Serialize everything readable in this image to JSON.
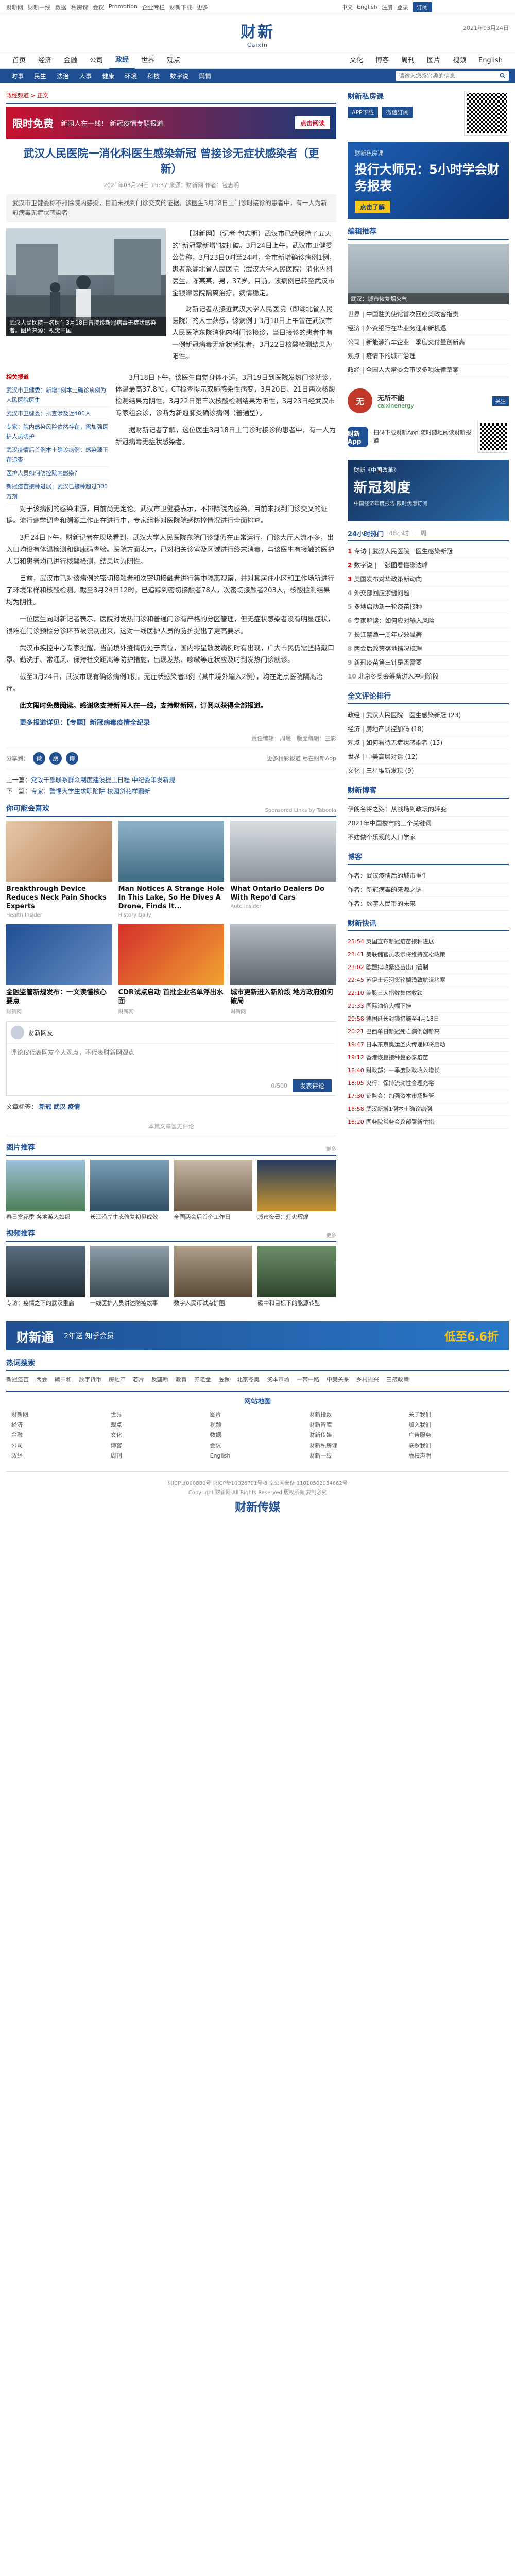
{
  "topbar": {
    "links": [
      "财新网",
      "财新一线",
      "数据",
      "私房课",
      "会议",
      "Promotion",
      "企业专栏",
      "财新下载",
      "更多"
    ],
    "right": [
      "中文",
      "English",
      "注册",
      "登录"
    ],
    "subscribe": "订阅"
  },
  "header": {
    "logo_cn": "财新",
    "logo_en": "Caixin",
    "date": "2021年03月24日"
  },
  "nav": {
    "items": [
      "首页",
      "经济",
      "金融",
      "公司",
      "政经",
      "世界",
      "观点",
      "文化",
      "博客",
      "周刊",
      "图片",
      "视频",
      "English"
    ],
    "active": "政经"
  },
  "subnav": {
    "items": [
      "时事",
      "民生",
      "法治",
      "人事",
      "健康",
      "环境",
      "科技",
      "数字说",
      "舆情"
    ],
    "search_placeholder": "请输入您感兴趣的信息"
  },
  "crumbs": "政经频道 > 正文",
  "banner": {
    "left": "限时免费",
    "mid": "新闻人在一线！ 新冠疫情专题报道",
    "btn": "点击阅读"
  },
  "article": {
    "title": "武汉人民医院一消化科医生感染新冠 曾接诊无症状感染者（更新）",
    "meta": "2021年03月24日 15:37  来源：财新网  作者：包志明",
    "summary": "武汉市卫健委称不排除院内感染，目前未找到门诊交叉的证据。该医生3月18日上门诊时接诊的患者中，有一人为新冠病毒无症状感染者",
    "photo_caption": "武汉人民医院一名医生3月18日曾接诊新冠病毒无症状感染者。图片来源：视觉中国",
    "lead_paragraphs": [
      "【财新网】（记者 包志明）武汉市已经保持了五天的“新冠零新增”被打破。3月24日上午，武汉市卫健委公告称，3月23日0时至24时，全市新增确诊病例1例，患者系湖北省人民医院（武汉大学人民医院）消化内科医生，陈某某，男，37岁。目前，该病例已转至武汉市金银潭医院隔离治疗，病情稳定。",
      "财新记者从接近武汉大学人民医院（即湖北省人民医院）的人士获悉，该病例于3月18日上午曾在武汉市人民医院东院消化内科门诊接诊，当日接诊的患者中有一例新冠病毒无症状感染者，3月22日核酸检测结果为阳性。"
    ],
    "related_head": "相关报道",
    "related": [
      "武汉市卫健委：新增1例本土确诊病例为人民医院医生",
      "武汉市卫健委：排查涉及近400人",
      "专家：院内感染风险依然存在，需加强医护人员防护",
      "武汉疫情后首例本土确诊病例：感染源正在追查",
      "医护人员如何防控院内感染？",
      "新冠疫苗接种进展：武汉已接种超过300万剂"
    ],
    "body_paragraphs": [
      "3月18日下午，该医生自觉身体不适，3月19日到医院发热门诊就诊，体温最高37.8℃，CT检查提示双肺感染性病变，3月20日、21日两次核酸检测结果为阴性，3月22日第三次核酸检测结果为阳性，3月23日经武汉市专家组会诊，诊断为新冠肺炎确诊病例（普通型）。",
      "据财新记者了解，这位医生3月18日上门诊时接诊的患者中，有一人为新冠病毒无症状感染者。",
      "对于该病例的感染来源，目前尚无定论。武汉市卫健委表示，不排除院内感染，目前未找到门诊交叉的证据。流行病学调查和溯源工作正在进行中，专家组将对医院院感防控情况进行全面排查。",
      "3月24日下午，财新记者在现场看到，武汉大学人民医院东院门诊部仍在正常运行，门诊大厅人流不多，出入口均设有体温检测和健康码查验。医院方面表示，已对相关诊室及区域进行终末消毒，与该医生有接触的医护人员和患者均已进行核酸检测，结果均为阴性。",
      "目前，武汉市已对该病例的密切接触者和次密切接触者进行集中隔离观察，并对其居住小区和工作场所进行了环境采样和核酸检测。截至3月24日12时，已追踪到密切接触者78人，次密切接触者203人，核酸检测结果均为阴性。",
      "一位医生向财新记者表示，医院对发热门诊和普通门诊有严格的分区管理，但无症状感染者没有明显症状，很难在门诊预检分诊环节被识别出来，这对一线医护人员的防护提出了更高要求。",
      "武汉市疾控中心专家提醒，当前境外疫情仍处于高位，国内零星散发病例时有出现，广大市民仍需坚持戴口罩、勤洗手、常通风、保持社交距离等防护措施，出现发热、咳嗽等症状应及时到发热门诊就诊。",
      "截至3月24日，武汉市现有确诊病例1例，无症状感染者3例（其中境外输入2例），均在定点医院隔离治疗。"
    ],
    "bold_note": "此文限时免费阅读。感谢您支持新闻人在一线，支持财新网，订阅以获得全部报道。",
    "more_reading": "更多报道详见：【专题】新冠病毒疫情全纪录",
    "editor": "责任编辑：周晟 | 版面编辑：王影"
  },
  "share": {
    "label": "分享到：",
    "icons": [
      "微",
      "朋",
      "博"
    ],
    "app_text": "更多精彩报道 尽在财新App"
  },
  "prevnext": {
    "prev_label": "上一篇：",
    "prev": "党政干部联系群众制度建设提上日程 中纪委印发新规",
    "next_label": "下一篇：",
    "next": "专家：警惕大学生求职陷阱 校园贷花样翻新"
  },
  "recommend": {
    "title": "你可能会喜欢",
    "tag": "Sponsored Links by Taboola",
    "cards": [
      {
        "title": "Breakthrough Device Reduces Neck Pain Shocks Experts",
        "source": "Health Insider"
      },
      {
        "title": "Man Notices A Strange Hole In This Lake, So He Dives A Drone, Finds It...",
        "source": "History Daily"
      },
      {
        "title": "What Ontario Dealers Do With Repo'd Cars",
        "source": "Auto Insider"
      },
      {
        "title": "金融监管新规发布：一文读懂核心要点",
        "source": "财新网"
      },
      {
        "title": "CDR试点启动 首批企业名单浮出水面",
        "source": "财新网"
      },
      {
        "title": "城市更新进入新阶段 地方政府如何破局",
        "source": "财新网"
      }
    ]
  },
  "comment": {
    "user": "财新网友",
    "placeholder": "评论仅代表网友个人观点，不代表财新网观点",
    "submit": "发表评论",
    "count_label": "0/500"
  },
  "tags": {
    "label": "文章标签：",
    "items": [
      "新冠",
      "武汉",
      "疫情"
    ]
  },
  "no_comment": "本篇文章暂无评论",
  "photo_strip": {
    "title": "图片推荐",
    "more": "更多",
    "items": [
      "春日赏花季 各地游人如织",
      "长江沿岸生态修复初见成效",
      "全国两会后首个工作日",
      "城市夜景：灯火辉煌"
    ]
  },
  "video_strip": {
    "title": "视频推荐",
    "more": "更多",
    "items": [
      "专访：疫情之下的武汉重启",
      "一线医护人员讲述防疫故事",
      "数字人民币试点扩围",
      "碳中和目标下的能源转型"
    ]
  },
  "wide_ad": {
    "left": "财新通",
    "mid": "2年送 知乎会员",
    "right": "低至6.6折"
  },
  "hot": {
    "title": "热词搜索",
    "words": [
      "新冠疫苗",
      "两会",
      "碳中和",
      "数字货币",
      "房地产",
      "芯片",
      "反垄断",
      "教育",
      "养老金",
      "医保",
      "北京冬奥",
      "资本市场",
      "一带一路",
      "中美关系",
      "乡村振兴",
      "三孩政策"
    ]
  },
  "footer": {
    "title": "网站地图",
    "cols": [
      [
        "财新网",
        "经济",
        "金融",
        "公司",
        "政经"
      ],
      [
        "世界",
        "观点",
        "文化",
        "博客",
        "周刊"
      ],
      [
        "图片",
        "视频",
        "数据",
        "会议",
        "English"
      ],
      [
        "财新指数",
        "财新智库",
        "财新传媒",
        "财新私房课",
        "财新一线"
      ],
      [
        "关于我们",
        "加入我们",
        "广告服务",
        "联系我们",
        "版权声明"
      ]
    ],
    "copyright": "京ICP证090880号 京ICP备10026701号-8 京公网安备 11010502034662号",
    "legal": "Copyright 财新网 All Rights Reserved 版权所有 复制必究",
    "logo": "财新传媒"
  },
  "right": {
    "qr_title": "财新私房课",
    "qr_buttons": [
      "APP下载",
      "微信订阅"
    ],
    "ad1_top": "财新私房课",
    "ad1_main": "投行大师兄：5小时学会财务报表",
    "ad1_btn": "点击了解",
    "pic_head": "编辑推荐",
    "pic_caption": "武汉：城市恢复烟火气",
    "pic_list": [
      "世界 | 中国驻美使馆首次回应美政客指责",
      "经济 | 外资银行在华业务迎来新机遇",
      "公司 | 新能源汽车企业一季度交付量创新高",
      "观点 | 疫情下的城市治理",
      "政经 | 全国人大常委会审议多项法律草案"
    ],
    "author_name": "无所不能",
    "author_sub": "caixinenergy",
    "author_btn": "关注",
    "app_title": "财新App",
    "app_desc": "扫码下载财新App 随时随地阅读财新报道",
    "ad2_top": "财新《中国改革》",
    "ad2_main": "新冠刻度",
    "ad2_sub": "中国经济年度报告 限时优惠订阅",
    "rank_head": "24小时热门",
    "rank_tabs": [
      "48小时",
      "一周"
    ],
    "rank": [
      "专访 | 武汉人民医院一医生感染新冠",
      "数字说 | 一张图看懂碳达峰",
      "美国发布对华政策新动向",
      "外交部回应涉疆问题",
      "多地启动新一轮疫苗接种",
      "专家解读：如何应对输入风险",
      "长江禁渔一周年成效显著",
      "两会后政策落地情况梳理",
      "新冠疫苗第三针是否需要",
      "北京冬奥会筹备进入冲刺阶段"
    ],
    "comment_head": "全文评论排行",
    "comment_rank": [
      "政经 | 武汉人民医院一医生感染新冠 (23)",
      "经济 | 房地产调控加码 (18)",
      "观点 | 如何看待无症状感染者 (15)",
      "世界 | 中美高层对话 (12)",
      "文化 | 三星堆新发现 (9)"
    ],
    "blog_head": "财新博客",
    "blog": [
      "伊朗名将之殇：从战场到政坛的转变",
      "2021年中国楼市的三个关键词",
      "不妨做个乐观的人口学家"
    ],
    "blogger_head": "博客",
    "bloggers": [
      "作者：武汉疫情后的城市重生",
      "作者：新冠病毒的来源之谜",
      "作者：数字人民币的未来"
    ],
    "flash_head": "财新快讯",
    "flash": [
      {
        "t": "23:54",
        "s": "英国宣布新冠疫苗接种进展"
      },
      {
        "t": "23:41",
        "s": "美联储官员表示将维持宽松政策"
      },
      {
        "t": "23:02",
        "s": "欧盟拟收紧疫苗出口管制"
      },
      {
        "t": "22:45",
        "s": "苏伊士运河货轮搁浅致航道堵塞"
      },
      {
        "t": "22:10",
        "s": "美股三大指数集体收跌"
      },
      {
        "t": "21:33",
        "s": "国际油价大幅下挫"
      },
      {
        "t": "20:58",
        "s": "德国延长封锁措施至4月18日"
      },
      {
        "t": "20:21",
        "s": "巴西单日新冠死亡病例创新高"
      },
      {
        "t": "19:47",
        "s": "日本东京奥运圣火传递即将启动"
      },
      {
        "t": "19:12",
        "s": "香港恢复接种复必泰疫苗"
      },
      {
        "t": "18:40",
        "s": "财政部：一季度财政收入增长"
      },
      {
        "t": "18:05",
        "s": "央行：保持流动性合理充裕"
      },
      {
        "t": "17:30",
        "s": "证监会：加强资本市场监管"
      },
      {
        "t": "16:58",
        "s": "武汉新增1例本土确诊病例"
      },
      {
        "t": "16:20",
        "s": "国务院常务会议部署新举措"
      }
    ]
  }
}
